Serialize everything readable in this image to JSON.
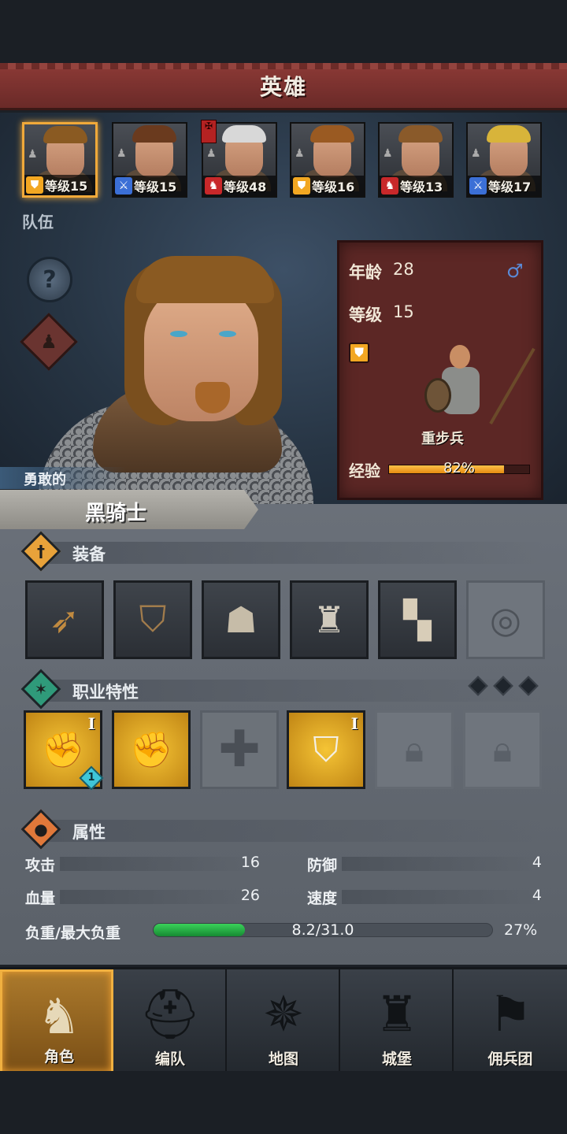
{
  "header": {
    "title": "英雄"
  },
  "roster": [
    {
      "level": "等级15",
      "class_icon": "shield-icon",
      "class_color": "#f2a722",
      "hair_color": "#8a5a22",
      "selected": true
    },
    {
      "level": "等级15",
      "class_icon": "sword-icon",
      "class_color": "#3b6fd6",
      "hair_color": "#6a3a1e",
      "selected": false
    },
    {
      "level": "等级48",
      "class_icon": "horse-icon",
      "class_color": "#c8282a",
      "hair_color": "#d8d8d8",
      "selected": false
    },
    {
      "level": "等级16",
      "class_icon": "shield-icon",
      "class_color": "#f2a722",
      "hair_color": "#9a5a22",
      "selected": false
    },
    {
      "level": "等级13",
      "class_icon": "horse-icon",
      "class_color": "#c8282a",
      "hair_color": "#8a5a2a",
      "selected": false
    },
    {
      "level": "等级17",
      "class_icon": "sword-icon",
      "class_color": "#3b6fd6",
      "hair_color": "#d8b43a",
      "selected": false
    }
  ],
  "team": {
    "label": "队伍"
  },
  "hero": {
    "trait": "勇敢的",
    "name": "黑骑士",
    "age_label": "年龄",
    "age": "28",
    "level_label": "等级",
    "level": "15",
    "gender_icon": "male-icon",
    "unit_name": "重步兵",
    "xp_label": "经验",
    "xp_percent_text": "82%",
    "xp_fraction": 0.82
  },
  "sections": {
    "equipment": "装备",
    "class_traits": "职业特性",
    "attributes": "属性"
  },
  "equipment": [
    {
      "name": "spear-icon",
      "glyph": "➶"
    },
    {
      "name": "shield-icon",
      "glyph": "⛉"
    },
    {
      "name": "hood-icon",
      "glyph": "☗"
    },
    {
      "name": "chainmail-icon",
      "glyph": "♜"
    },
    {
      "name": "boots-icon",
      "glyph": "▚"
    },
    {
      "name": "ring-icon",
      "glyph": "◎",
      "empty": true
    }
  ],
  "skills": [
    {
      "type": "gold",
      "rank": "I",
      "gem": "1"
    },
    {
      "type": "gold",
      "rank": "",
      "gem": ""
    },
    {
      "type": "cross",
      "rank": "",
      "gem": ""
    },
    {
      "type": "gold",
      "rank": "I",
      "gem": ""
    },
    {
      "type": "locked",
      "rank": "",
      "gem": ""
    },
    {
      "type": "locked",
      "rank": "",
      "gem": ""
    }
  ],
  "attributes": {
    "attack_label": "攻击",
    "attack": "16",
    "defense_label": "防御",
    "defense": "4",
    "hp_label": "血量",
    "hp": "26",
    "speed_label": "速度",
    "speed": "4",
    "load_label": "负重/最大负重",
    "load_text": "8.2/31.0",
    "load_percent": "27%",
    "load_fraction": 0.27
  },
  "nav": [
    {
      "label": "角色",
      "icon": "knight-icon",
      "active": true
    },
    {
      "label": "编队",
      "icon": "helmet-icon",
      "active": false
    },
    {
      "label": "地图",
      "icon": "compass-icon",
      "active": false
    },
    {
      "label": "城堡",
      "icon": "castle-icon",
      "active": false
    },
    {
      "label": "佣兵团",
      "icon": "mercenary-banner-icon",
      "active": false
    }
  ],
  "colors": {
    "accent_gold": "#f0a93a",
    "card_red": "#5c2725",
    "panel_grey": "#6a7079"
  }
}
